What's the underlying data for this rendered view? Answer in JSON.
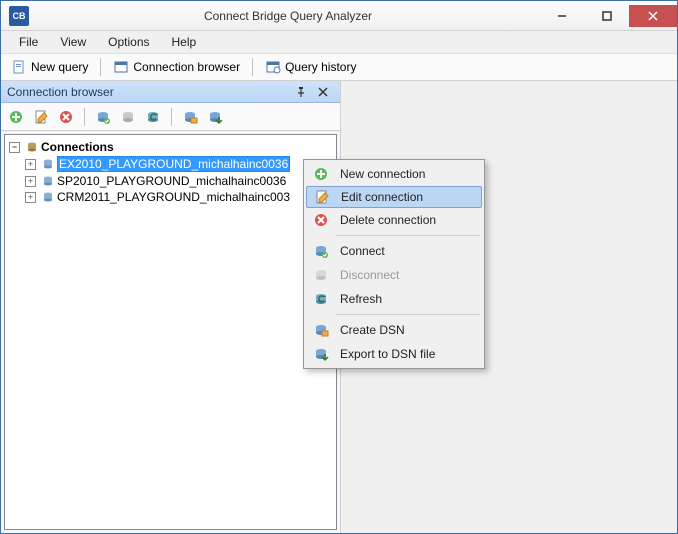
{
  "window": {
    "title": "Connect Bridge Query Analyzer"
  },
  "menubar": {
    "items": [
      "File",
      "View",
      "Options",
      "Help"
    ]
  },
  "toolbar": {
    "new_query": "New query",
    "connection_browser": "Connection browser",
    "query_history": "Query history"
  },
  "panel": {
    "title": "Connection browser",
    "root_label": "Connections",
    "items": [
      "EX2010_PLAYGROUND_michalhainc0036",
      "SP2010_PLAYGROUND_michalhainc0036",
      "CRM2011_PLAYGROUND_michalhainc003"
    ]
  },
  "context_menu": {
    "new_connection": "New connection",
    "edit_connection": "Edit connection",
    "delete_connection": "Delete connection",
    "connect": "Connect",
    "disconnect": "Disconnect",
    "refresh": "Refresh",
    "create_dsn": "Create DSN",
    "export_dsn": "Export to DSN file"
  },
  "icons": {
    "add": "add-icon",
    "edit": "edit-icon",
    "delete": "delete-icon",
    "connect": "connect-icon",
    "disconnect": "disconnect-icon",
    "refresh": "refresh-icon",
    "dsn": "dsn-icon",
    "export": "export-icon",
    "db": "database-icon",
    "doc": "document-icon",
    "window": "window-icon",
    "history": "history-icon",
    "pin": "pin-icon",
    "close": "close-icon"
  }
}
